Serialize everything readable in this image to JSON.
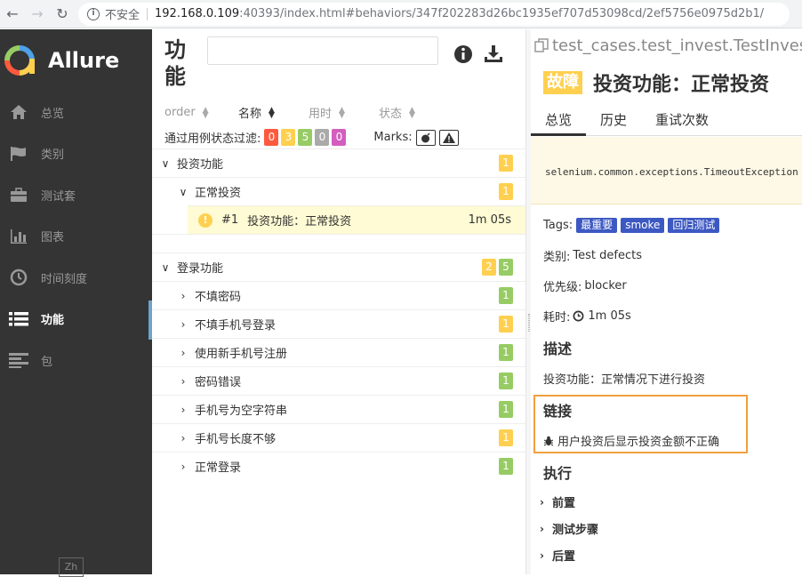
{
  "browser": {
    "insecure_label": "不安全",
    "url_host": "192.168.0.109",
    "url_path": ":40393/index.html#behaviors/347f202283d26bc1935ef707d53098cd/2ef5756e0975d2b1/"
  },
  "sidebar": {
    "brand": "Allure",
    "items": [
      {
        "label": "总览",
        "icon": "home-icon"
      },
      {
        "label": "类别",
        "icon": "flag-icon"
      },
      {
        "label": "测试套",
        "icon": "briefcase-icon"
      },
      {
        "label": "图表",
        "icon": "bar-chart-icon"
      },
      {
        "label": "时间刻度",
        "icon": "clock-icon"
      },
      {
        "label": "功能",
        "icon": "list-icon",
        "active": true
      },
      {
        "label": "包",
        "icon": "align-left-icon"
      }
    ],
    "language": "Zh"
  },
  "behaviors": {
    "title": "功能",
    "search_placeholder": "",
    "sort": [
      {
        "label": "order"
      },
      {
        "label": "名称",
        "active": true
      },
      {
        "label": "用时"
      },
      {
        "label": "状态"
      }
    ],
    "filter_label": "通过用例状态过滤:",
    "filter_counts": [
      "0",
      "3",
      "5",
      "0",
      "0"
    ],
    "marks_label": "Marks:",
    "groups": [
      {
        "name": "投资功能",
        "badges": [
          "1"
        ],
        "children": [
          {
            "name": "正常投资",
            "badges": [
              "1"
            ],
            "leaf": {
              "order": "#1",
              "name": "投资功能：正常投资",
              "duration": "1m 05s"
            }
          }
        ]
      },
      {
        "name": "登录功能",
        "badges": [
          "2",
          "5"
        ],
        "children": [
          {
            "name": "不填密码",
            "badge": "1",
            "color": "green"
          },
          {
            "name": "不填手机号登录",
            "badge": "1",
            "color": "orange"
          },
          {
            "name": "使用新手机号注册",
            "badge": "1",
            "color": "green"
          },
          {
            "name": "密码错误",
            "badge": "1",
            "color": "green"
          },
          {
            "name": "手机号为空字符串",
            "badge": "1",
            "color": "green"
          },
          {
            "name": "手机号长度不够",
            "badge": "1",
            "color": "orange"
          },
          {
            "name": "正常登录",
            "badge": "1",
            "color": "green"
          }
        ]
      }
    ]
  },
  "testcase": {
    "path": "test_cases.test_invest.TestInvest#t",
    "status": "故障",
    "title": "投资功能：正常投资",
    "tabs": [
      "总览",
      "历史",
      "重试次数"
    ],
    "error": "selenium.common.exceptions.TimeoutException",
    "tags_label": "Tags:",
    "tags": [
      "最重要",
      "smoke",
      "回归测试"
    ],
    "category_label": "类别:",
    "category": "Test defects",
    "severity_label": "优先级:",
    "severity": "blocker",
    "duration_label": "耗时:",
    "duration": "1m 05s",
    "description_heading": "描述",
    "description": "投资功能：正常情况下进行投资",
    "links_heading": "链接",
    "link": "用户投资后显示投资金额不正确",
    "execution_heading": "执行",
    "execution_items": [
      "前置",
      "测试步骤",
      "后置"
    ]
  }
}
